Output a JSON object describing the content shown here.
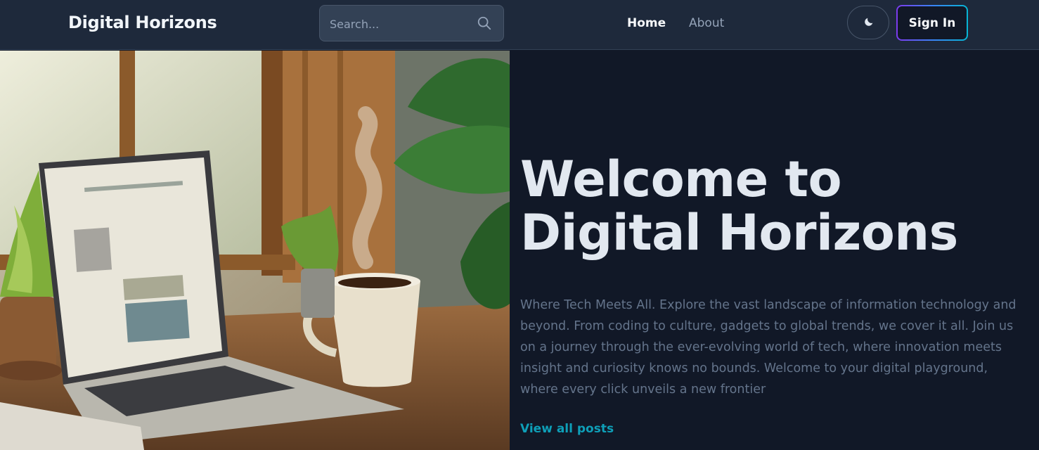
{
  "navbar": {
    "brand": "Digital Horizons",
    "search_placeholder": "Search...",
    "links": {
      "home": "Home",
      "about": "About"
    },
    "sign_in": "Sign In"
  },
  "hero": {
    "title": "Welcome to Digital Horizons",
    "description": "Where Tech Meets All. Explore the vast landscape of information technology and beyond. From coding to culture, gadgets to global trends, we cover it all. Join us on a journey through the ever-evolving world of tech, where innovation meets insight and curiosity knows no bounds. Welcome to your digital playground, where every click unveils a new frontier",
    "cta": "View all posts"
  },
  "icons": {
    "search": "search-icon",
    "theme": "moon-icon"
  },
  "colors": {
    "navbar_bg": "#1e293b",
    "page_bg": "#111827",
    "accent_link": "#0e9fb8",
    "signin_border_gradient": [
      "#7c3aed",
      "#3b82f6",
      "#06b6d4"
    ]
  }
}
